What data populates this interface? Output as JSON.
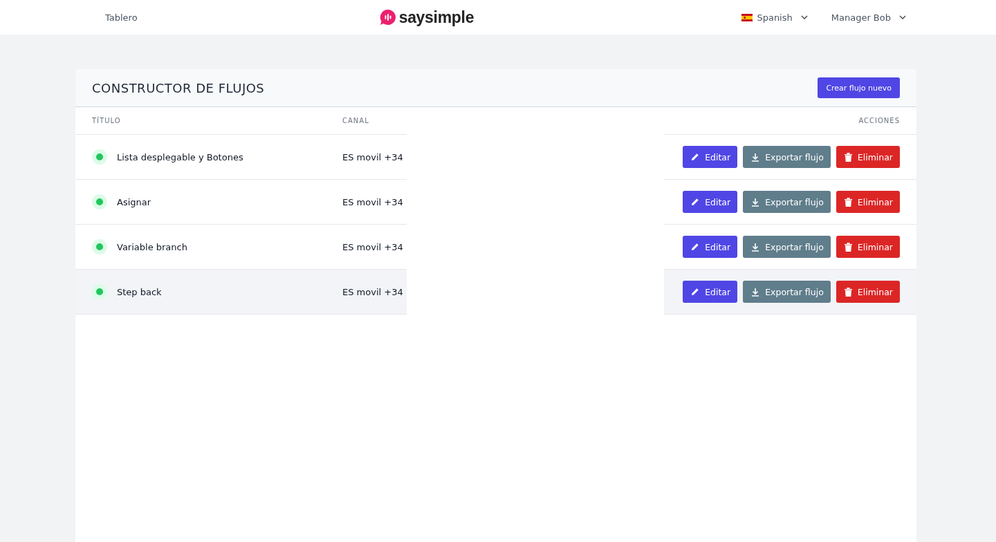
{
  "nav": {
    "link": "Tablero",
    "logo": "saysimple",
    "language": "Spanish",
    "user": "Manager Bob"
  },
  "card": {
    "title": "CONSTRUCTOR DE FLUJOS",
    "create_button": "Crear flujo nuevo"
  },
  "table": {
    "columns": [
      "TÍTULO",
      "CANAL",
      "ACCIONES"
    ],
    "rows": [
      {
        "title": "Lista desplegable y Botones",
        "channel": "ES movil +34",
        "active": true,
        "hovered": false,
        "actions": {
          "edit": "Editar",
          "export": "Exportar flujo",
          "delete": "Eliminar"
        }
      },
      {
        "title": "Asignar",
        "channel": "ES movil +34",
        "active": true,
        "hovered": false,
        "actions": {
          "edit": "Editar",
          "export": "Exportar flujo",
          "delete": "Eliminar"
        }
      },
      {
        "title": "Variable branch",
        "channel": "ES movil +34",
        "active": true,
        "hovered": false,
        "actions": {
          "edit": "Editar",
          "export": "Exportar flujo",
          "delete": "Eliminar"
        }
      },
      {
        "title": "Step back",
        "channel": "ES movil +34",
        "active": true,
        "hovered": true,
        "actions": {
          "edit": "Editar",
          "export": "Exportar flujo",
          "delete": "Eliminar"
        }
      }
    ]
  }
}
